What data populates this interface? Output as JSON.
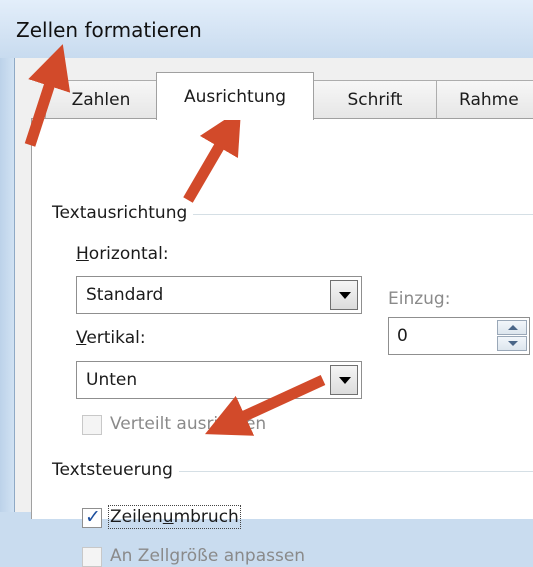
{
  "window": {
    "title": "Zellen formatieren"
  },
  "tabs": [
    {
      "label": "Zahlen",
      "active": false
    },
    {
      "label": "Ausrichtung",
      "active": true
    },
    {
      "label": "Schrift",
      "active": false
    },
    {
      "label": "Rahme",
      "active": false
    }
  ],
  "text_alignment": {
    "group_label": "Textausrichtung",
    "horizontal_label": "Horizontal:",
    "horizontal_value": "Standard",
    "vertical_label": "Vertikal:",
    "vertical_value": "Unten",
    "indent_label": "Einzug:",
    "indent_value": "0",
    "distributed_label": "Verteilt ausrichten",
    "distributed_checked": false
  },
  "text_control": {
    "group_label": "Textsteuerung",
    "wrap_label": "Zeilenumbruch",
    "wrap_checked": true,
    "shrink_label": "An Zellgröße anpassen",
    "shrink_checked": false
  },
  "colors": {
    "annotation_arrow": "#d24a2a",
    "check_mark": "#1d4f9e"
  }
}
